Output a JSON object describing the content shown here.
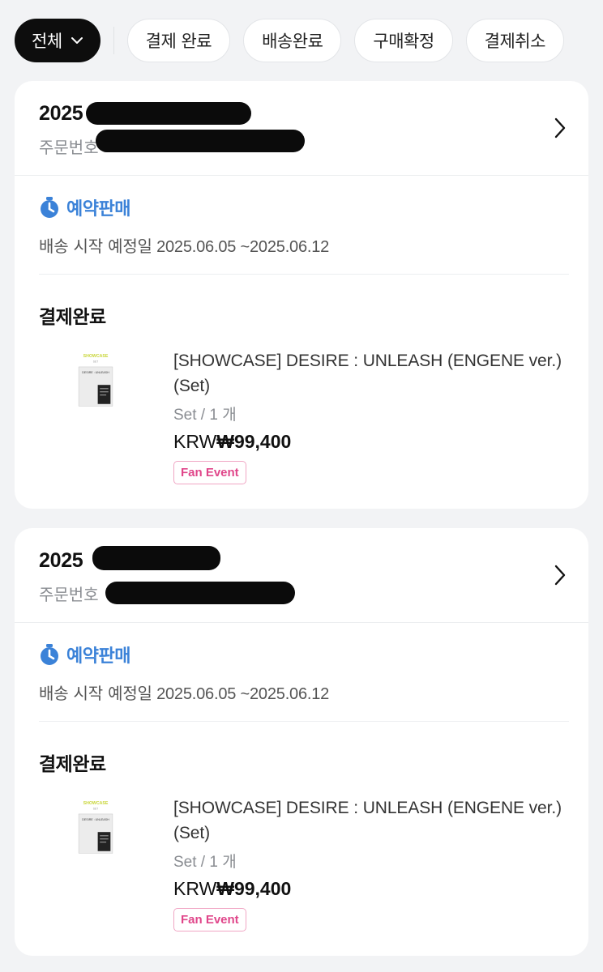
{
  "filters": {
    "all_label": "전체",
    "items": [
      "결제 완료",
      "배송완료",
      "구매확정",
      "결제취소"
    ]
  },
  "orders": [
    {
      "date_prefix": "2025",
      "order_no_label": "주문번호",
      "preorder_label": "예약판매",
      "ship_label": "배송 시작 예정일",
      "ship_range": "2025.06.05 ~2025.06.12",
      "status": "결제완료",
      "product": {
        "name": "[SHOWCASE] DESIRE : UNLEASH (ENGENE ver.) (Set)",
        "option": "Set / 1 개",
        "currency": "KRW",
        "price": "₩99,400",
        "badge": "Fan Event",
        "thumb_top_text": "SHOWCASE",
        "thumb_sub_text": "SET",
        "thumb_album_text": "DESIRE : UNLEASH"
      }
    },
    {
      "date_prefix": "2025",
      "order_no_label": "주문번호",
      "preorder_label": "예약판매",
      "ship_label": "배송 시작 예정일",
      "ship_range": "2025.06.05 ~2025.06.12",
      "status": "결제완료",
      "product": {
        "name": "[SHOWCASE] DESIRE : UNLEASH (ENGENE ver.) (Set)",
        "option": "Set / 1 개",
        "currency": "KRW",
        "price": "₩99,400",
        "badge": "Fan Event",
        "thumb_top_text": "SHOWCASE",
        "thumb_sub_text": "SET",
        "thumb_album_text": "DESIRE : UNLEASH"
      }
    }
  ],
  "colors": {
    "accent_blue": "#3b82d8",
    "badge_pink": "#e0468a",
    "chip_active": "#0d0d0d"
  }
}
